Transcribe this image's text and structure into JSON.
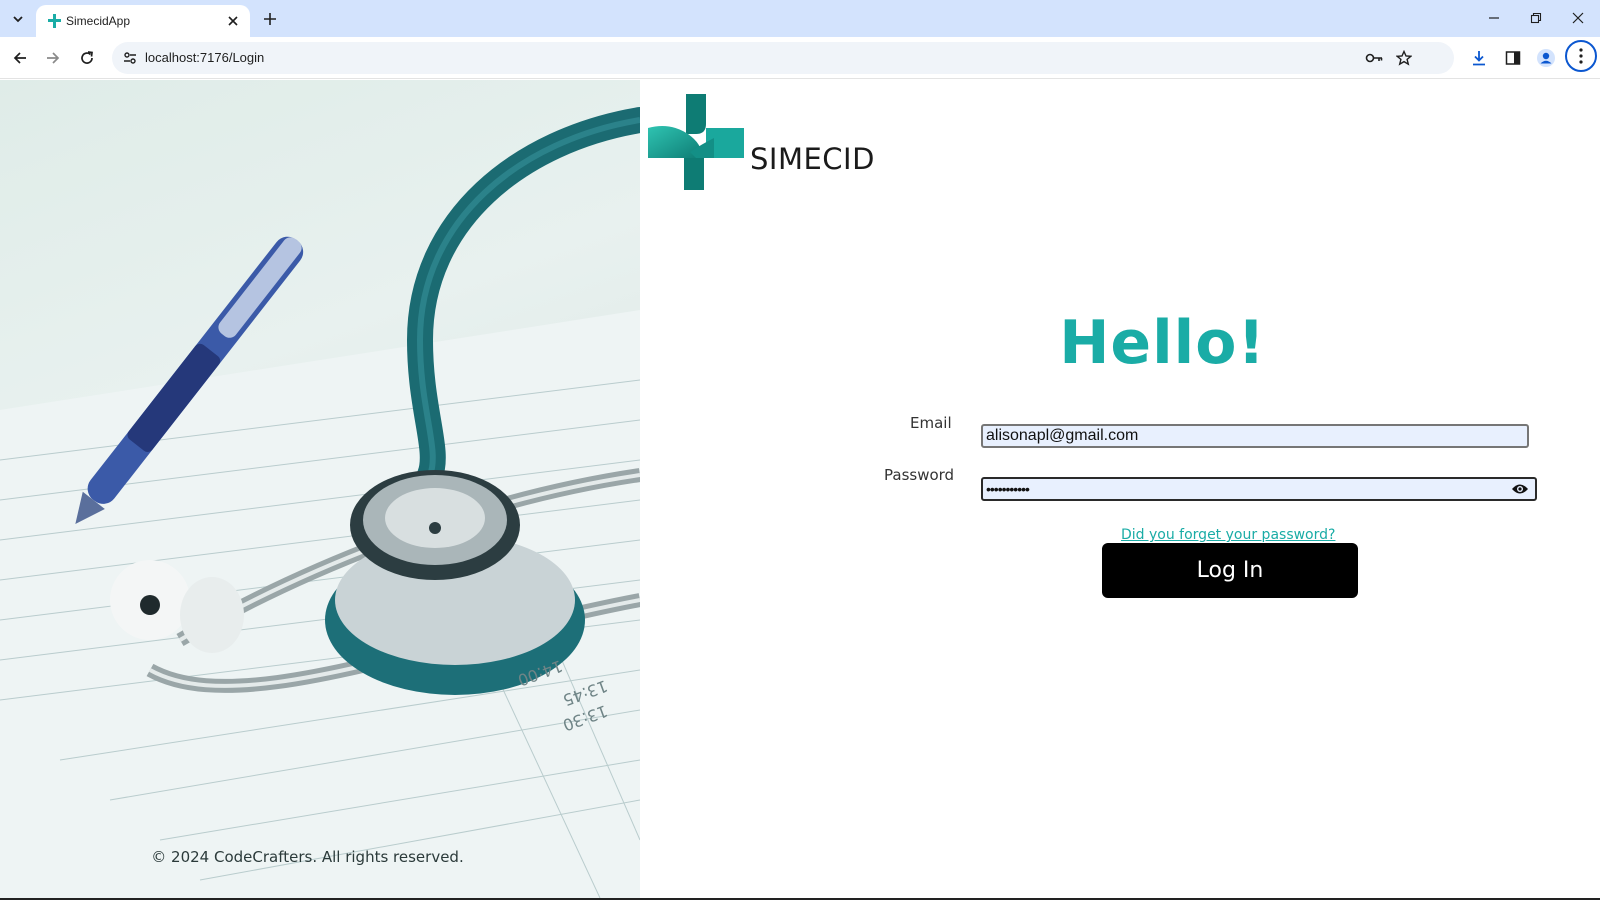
{
  "browser": {
    "tab_title": "SimecidApp",
    "url": "localhost:7176/Login"
  },
  "brand": {
    "logo_text": "SIMECID",
    "accent_color": "#1aaca6",
    "logo_dark_color": "#0e7c74"
  },
  "login": {
    "heading": "Hello!",
    "email_label": "Email",
    "email_value": "alisonapl@gmail.com",
    "password_label": "Password",
    "password_value": "•••••••••••",
    "forgot_link": "Did you forget your password?",
    "submit_label": "Log In"
  },
  "footer": {
    "copyright": "© 2024 CodeCrafters. All rights reserved."
  },
  "icons": [
    "tab-list-icon",
    "favicon-icon",
    "close-icon",
    "plus-icon",
    "minimize-icon",
    "restore-icon",
    "back-icon",
    "forward-icon",
    "reload-icon",
    "site-info-icon",
    "key-icon",
    "star-icon",
    "download-icon",
    "side-panel-icon",
    "profile-icon",
    "kebab-menu-icon",
    "eye-icon"
  ]
}
